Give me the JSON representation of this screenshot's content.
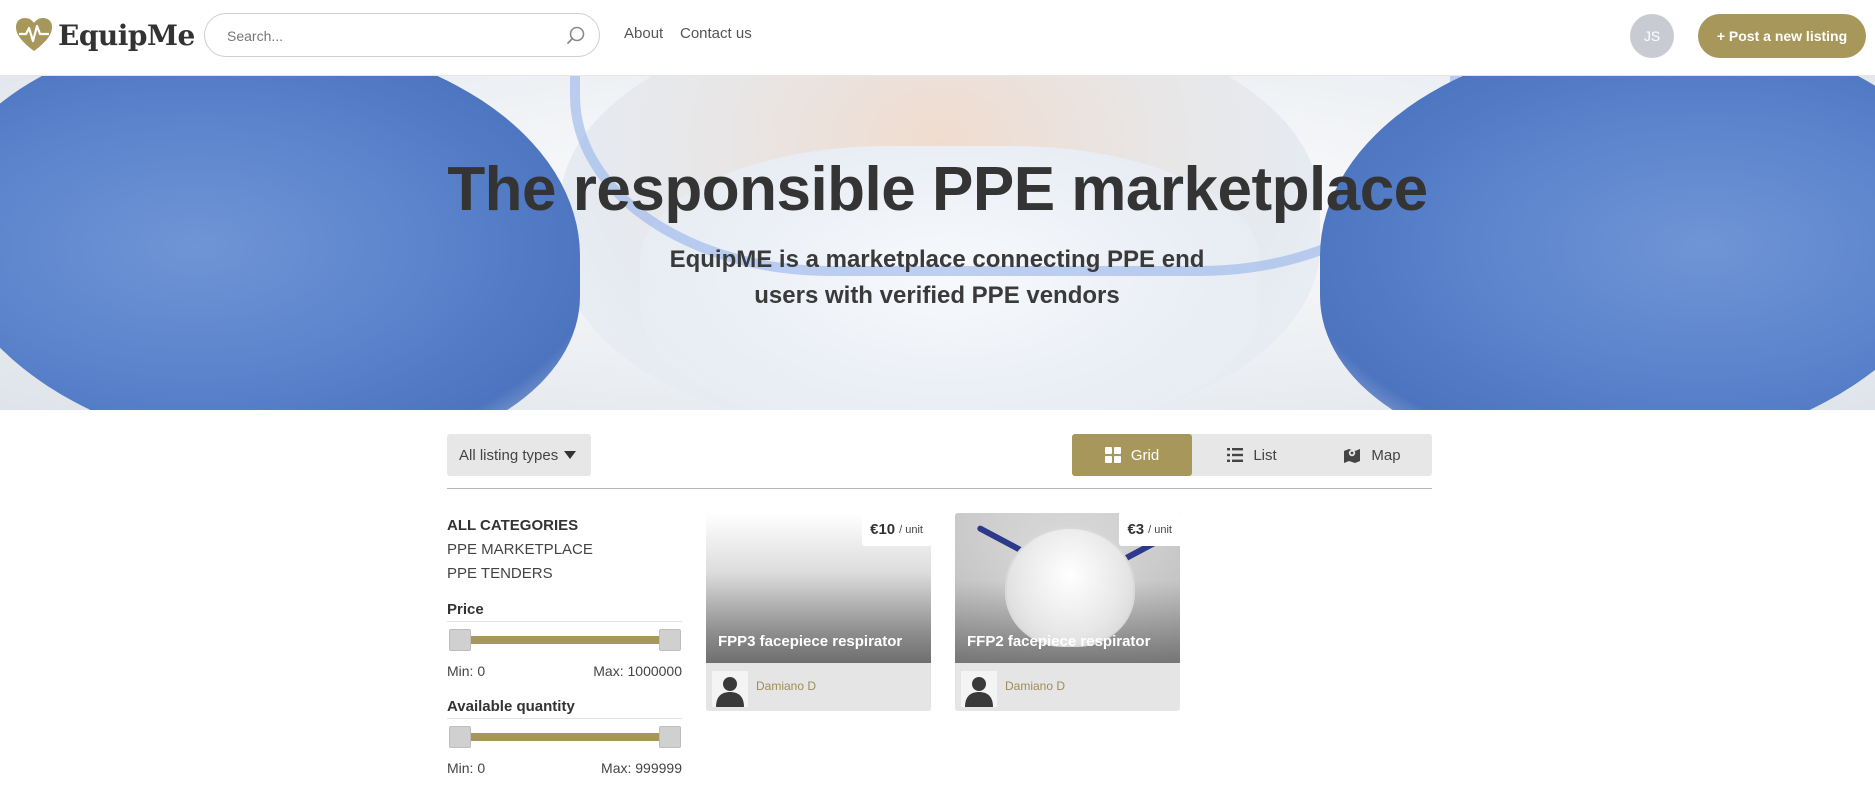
{
  "header": {
    "logo_text": "EquipMe",
    "search_placeholder": "Search...",
    "nav": [
      {
        "label": "About"
      },
      {
        "label": "Contact us"
      }
    ],
    "avatar_initials": "JS",
    "post_button_label": "+ Post a new listing"
  },
  "hero": {
    "title": "The responsible PPE marketplace",
    "subtitle": "EquipME is a marketplace connecting PPE end users with verified PPE vendors"
  },
  "filters": {
    "listing_type_label": "All listing types",
    "views": [
      {
        "label": "Grid",
        "icon": "grid-icon",
        "active": true
      },
      {
        "label": "List",
        "icon": "list-icon",
        "active": false
      },
      {
        "label": "Map",
        "icon": "map-icon",
        "active": false
      }
    ]
  },
  "sidebar": {
    "categories_heading": "ALL CATEGORIES",
    "categories": [
      {
        "label": "PPE MARKETPLACE"
      },
      {
        "label": "PPE TENDERS"
      }
    ],
    "price": {
      "label": "Price",
      "min_label": "Min: 0",
      "max_label": "Max: 1000000"
    },
    "quantity": {
      "label": "Available quantity",
      "min_label": "Min: 0",
      "max_label": "Max: 999999"
    }
  },
  "listings": [
    {
      "title": "FPP3 facepiece respirator",
      "price": "€10",
      "unit": "/ unit",
      "author": "Damiano D"
    },
    {
      "title": "FFP2 facepiece respirator",
      "price": "€3",
      "unit": "/ unit",
      "author": "Damiano D"
    }
  ],
  "colors": {
    "accent": "#a8975a",
    "avatar_bg": "#c8cbd2"
  }
}
